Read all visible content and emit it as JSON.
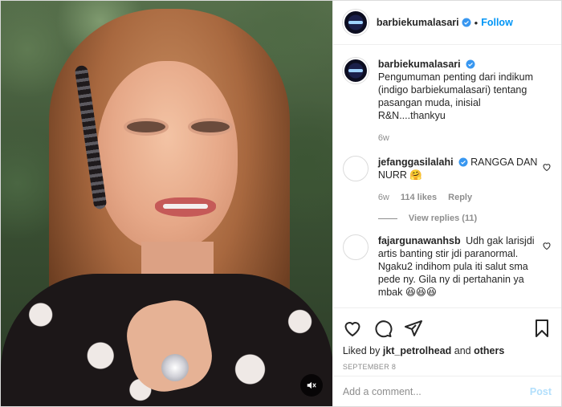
{
  "post": {
    "username": "barbiekumalasari",
    "follow_label": "Follow",
    "dot": "•",
    "mute_icon": "speaker-muted-icon"
  },
  "comments": [
    {
      "username": "barbiekumalasari",
      "text": "Pengumuman penting dari indikum (indigo barbiekumalasari) tentang pasangan muda, inisial R&N....thankyu",
      "age": "6w",
      "verified": true
    },
    {
      "username": "jefanggasilalahi",
      "text": "RANGGA DAN NURR 🤗",
      "age": "6w",
      "likes": "114 likes",
      "reply_label": "Reply",
      "verified": true,
      "view_replies": "View replies (11)"
    },
    {
      "username": "fajargunawanhsb",
      "text": "Udh gak larisjdi artis banting stir jdi paranormal. Ngaku2 indihom pula iti salut sma pede ny. Gila ny di pertahanin ya mbak 😆😆😆",
      "verified": false
    }
  ],
  "actions": {
    "liked_by_prefix": "Liked by",
    "liked_by_user": "jkt_petrolhead",
    "liked_by_and": "and",
    "liked_by_others": "others",
    "date": "SEPTEMBER 8"
  },
  "composer": {
    "placeholder": "Add a comment...",
    "post_label": "Post"
  },
  "colors": {
    "link_blue": "#0095f6",
    "verified_blue": "#3897f0",
    "muted_text": "#8e8e8e",
    "post_disabled": "#b2dffc"
  }
}
